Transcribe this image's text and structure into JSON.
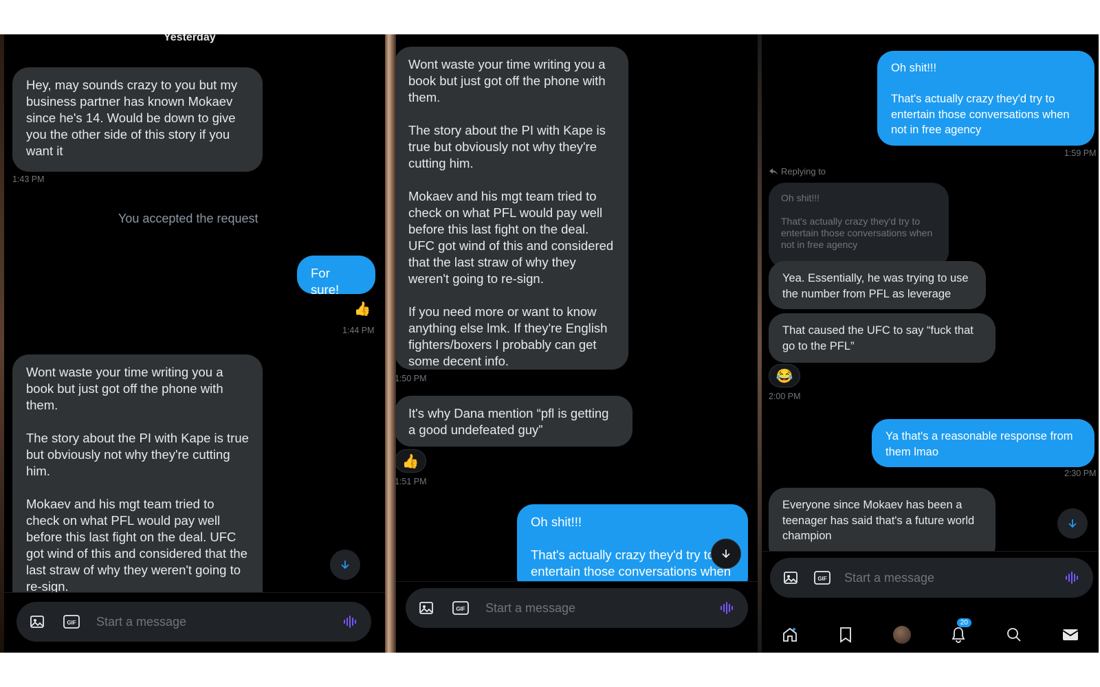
{
  "panel1": {
    "date_divider": "Yesterday",
    "msg1": "Hey, may sounds crazy to you but my business partner has known Mokaev since he's 14. Would be down to give you the other side of this story if you want it",
    "ts1": "1:43 PM",
    "system": "You accepted the request",
    "reply1": "For sure!",
    "reaction1": "👍",
    "ts2": "1:44 PM",
    "msg2": "Wont waste your time writing you a book but just got off the phone with them.\n\nThe story about the PI with Kape is true but obviously not why they're cutting him.\n\nMokaev and his mgt team tried to check on what PFL would pay well before this last fight on the deal. UFC got wind of this and considered that the last straw of why they weren't going to re-sign.",
    "composer_placeholder": "Start a message"
  },
  "panel2": {
    "msg1": "Wont waste your time writing you a book but just got off the phone with them.\n\nThe story about the PI with Kape is true but obviously not why they're cutting him.\n\nMokaev and his mgt team tried to check on what PFL would pay well before this last fight on the deal. UFC got wind of this and considered that the last straw of why they weren't going to re-sign.\n\nIf you need more or want to know anything else lmk. If they're English fighters/boxers I probably can get some decent info.",
    "ts1": "1:50 PM",
    "msg2": "It's why Dana mention “pfl is getting a good undefeated guy”",
    "reaction": "👍",
    "ts2": "1:51 PM",
    "out1": "Oh shit!!!\n\nThat's actually crazy they'd try to entertain those conversations when",
    "composer_placeholder": "Start a message"
  },
  "panel3": {
    "out1": "Oh shit!!!\n\nThat's actually crazy they'd try to entertain those conversations when not in free agency",
    "ts1": "1:59 PM",
    "replying_to": "Replying to",
    "quoted": "Oh shit!!!\n\nThat's actually crazy they'd try to entertain those conversations when not in free agency",
    "msg1": "Yea. Essentially, he was trying to use the number from PFL as leverage",
    "msg2": "That caused the UFC to say “fuck that go to the PFL”",
    "reaction": "😂",
    "ts2": "2:00 PM",
    "out2": "Ya that's a reasonable response from them lmao",
    "ts3": "2:30 PM",
    "msg3": "Everyone since Mokaev has been a teenager has said that's a future world champion",
    "composer_placeholder": "Start a message",
    "nav": {
      "notifications_badge": "20",
      "icons": [
        "home-icon",
        "bookmark-icon",
        "profile-avatar",
        "bell-icon",
        "search-icon",
        "mail-icon"
      ]
    }
  },
  "colors": {
    "accent": "#1d9bf0",
    "incoming": "#2f3336",
    "background": "#000000"
  }
}
